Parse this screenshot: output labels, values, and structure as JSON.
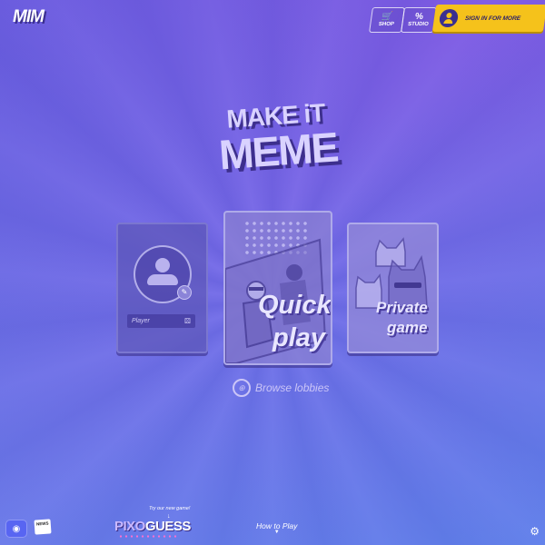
{
  "header": {
    "logo_text": "MIM",
    "shop_label": "SHOP",
    "studio_label": "STUDIO",
    "signin_label": "SIGN IN FOR MORE",
    "shop_icon": "cart-icon",
    "studio_icon": "percent-icon",
    "signin_icon": "user-avatar-icon"
  },
  "title": {
    "line1": "MAKE iT",
    "line2": "MEME"
  },
  "cards": {
    "player": {
      "name_placeholder": "Player",
      "avatar_icon": "user-icon",
      "edit_icon": "pencil-icon",
      "randomize_icon": "dice-icon"
    },
    "quick": {
      "line1": "Quick",
      "line2": "play"
    },
    "private": {
      "line1": "Private",
      "line2": "game"
    }
  },
  "browse": {
    "label": "Browse lobbies",
    "icon": "globe-icon"
  },
  "footer": {
    "discord_icon": "discord-icon",
    "news_label": "NEWS",
    "try_note": "Try our new game!",
    "promo_name_part1": "PIXO",
    "promo_name_part2": "GUESS",
    "how_to_play": "How to Play",
    "settings_icon": "gear-icon"
  },
  "colors": {
    "accent_yellow": "#f5c21b",
    "dark_purple": "#3b2f8f",
    "background": "#6d63e0"
  }
}
